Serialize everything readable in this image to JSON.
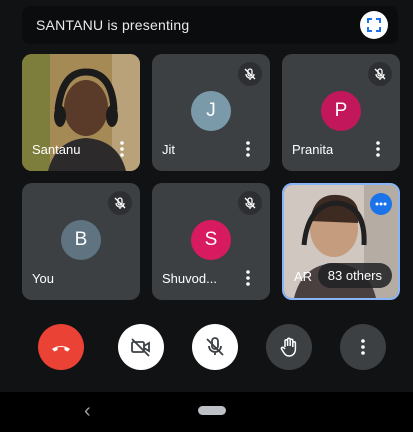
{
  "banner": {
    "text": "SANTANU is presenting",
    "fullscreen_icon": "fullscreen-icon"
  },
  "tiles": [
    {
      "name": "Santanu",
      "type": "video"
    },
    {
      "name": "Jit",
      "initial": "J",
      "avatar_color": "#7b9aa9",
      "muted": true
    },
    {
      "name": "Pranita",
      "initial": "P",
      "avatar_color": "#c2185b",
      "muted": true
    },
    {
      "name": "You",
      "initial": "B",
      "avatar_color": "#5f7380",
      "muted": true
    },
    {
      "name": "Shuvod...",
      "initial": "S",
      "avatar_color": "#d81b60",
      "muted": true
    },
    {
      "name": "AR",
      "type": "video",
      "others_label": "83 others",
      "speaking": true
    }
  ],
  "controls": {
    "end_call_color": "#ea4335",
    "camera": "camera-off-icon",
    "mic": "mic-off-icon",
    "raise_hand": "hand-icon",
    "more": "more-vert-icon"
  },
  "nav": {
    "back": "‹"
  }
}
